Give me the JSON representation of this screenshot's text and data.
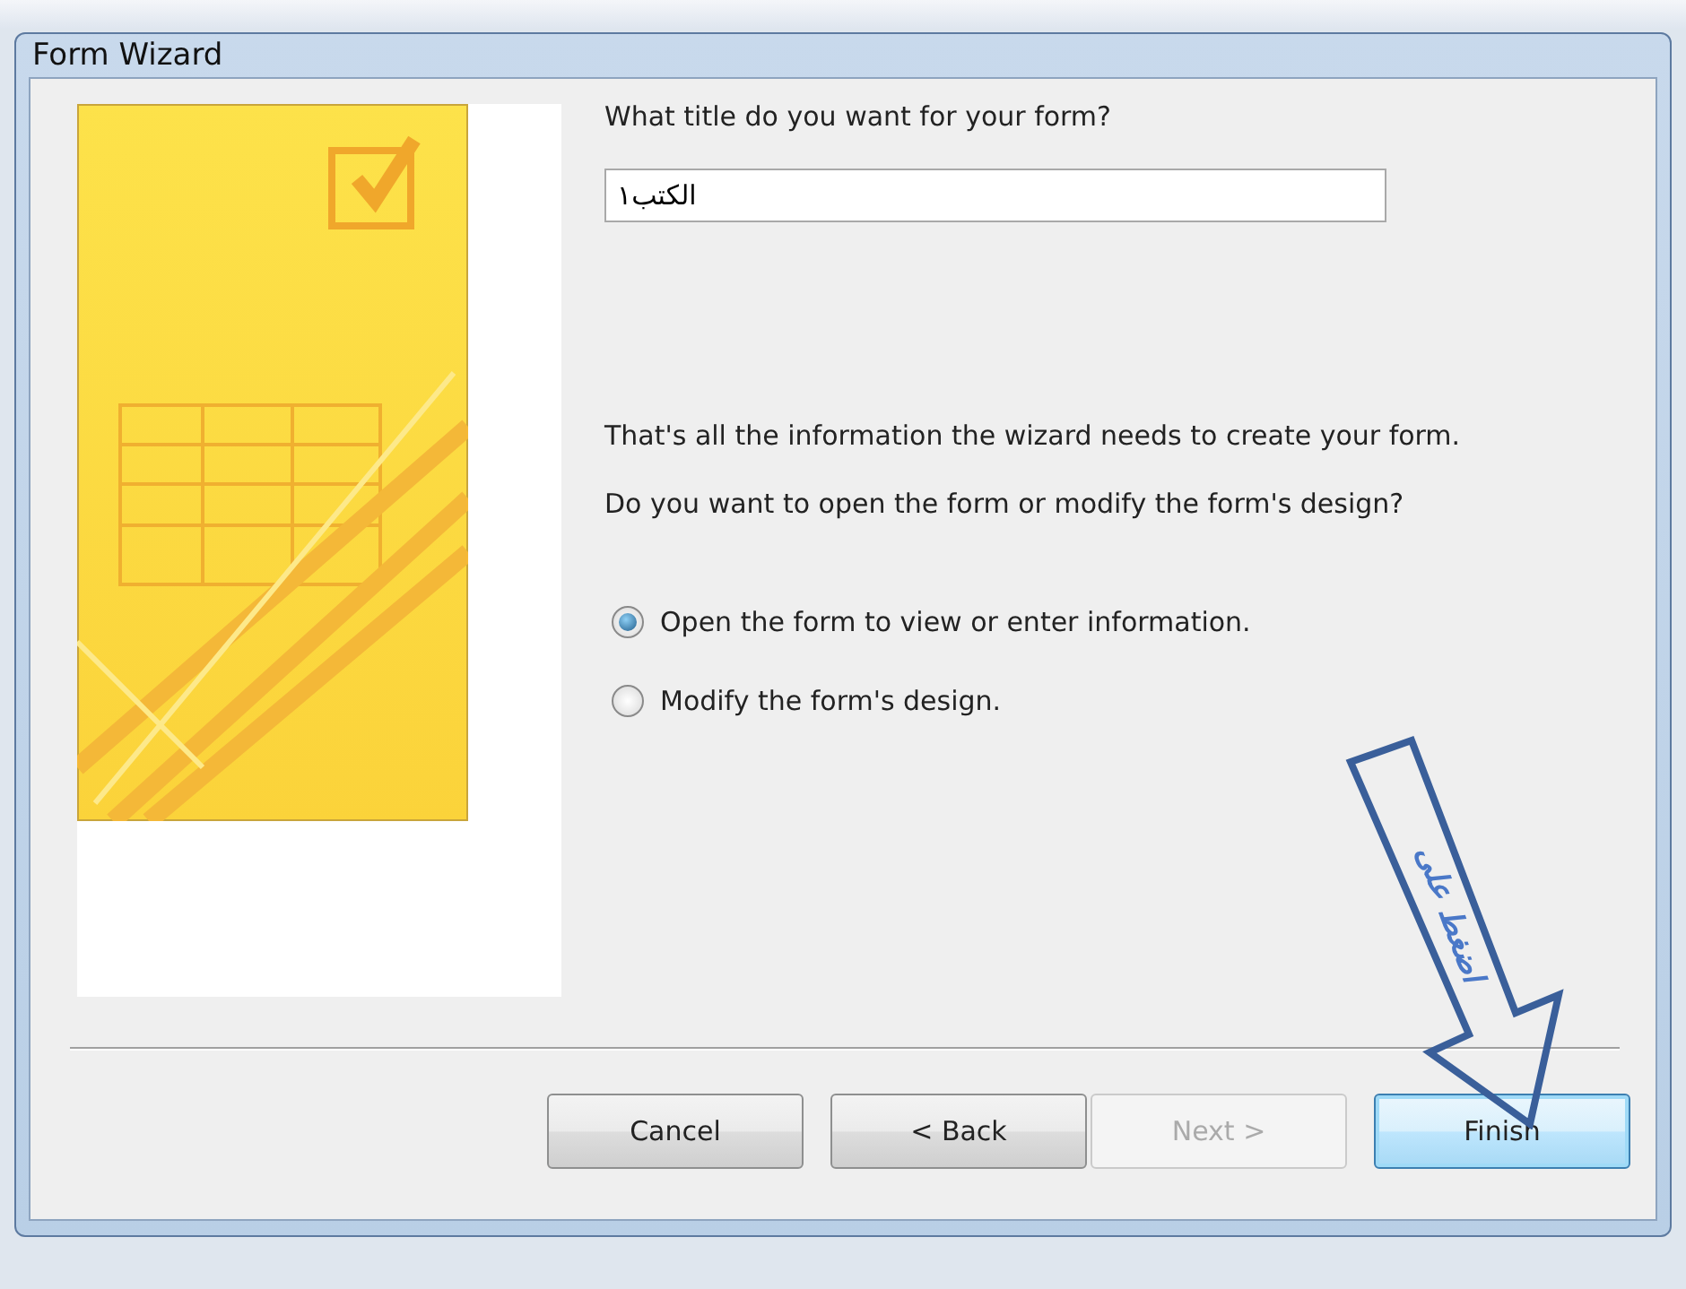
{
  "window": {
    "title": "Form Wizard"
  },
  "prompt": "What title do you want for your form?",
  "title_field": {
    "value": "الكتب١"
  },
  "info_text": "That's all the information the wizard needs to create your form.",
  "question": "Do you want to open the form or modify the form's design?",
  "options": [
    {
      "label": "Open the form to view or enter information.",
      "selected": true
    },
    {
      "label": "Modify the form's design.",
      "selected": false
    }
  ],
  "buttons": [
    {
      "label": "Cancel",
      "disabled": false,
      "focused": false
    },
    {
      "label": "< Back",
      "disabled": false,
      "focused": false
    },
    {
      "label": "Next >",
      "disabled": true,
      "focused": false
    },
    {
      "label": "Finish",
      "disabled": false,
      "focused": true
    }
  ],
  "annotation": {
    "text": "اضغط على"
  }
}
